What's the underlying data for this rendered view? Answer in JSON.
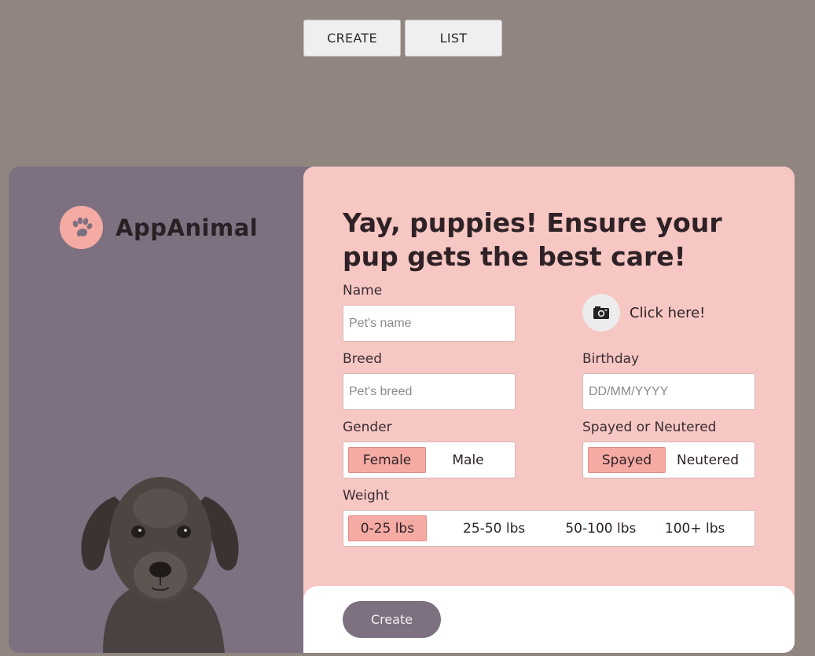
{
  "nav": {
    "create_label": "CREATE",
    "list_label": "LIST"
  },
  "brand": {
    "name": "AppAnimal"
  },
  "form": {
    "headline": "Yay, puppies! Ensure your pup gets the best care!",
    "name": {
      "label": "Name",
      "placeholder": "Pet's name"
    },
    "photo": {
      "label": "Click here!"
    },
    "breed": {
      "label": "Breed",
      "placeholder": "Pet's breed"
    },
    "birthday": {
      "label": "Birthday",
      "placeholder": "DD/MM/YYYY"
    },
    "gender": {
      "label": "Gender",
      "options": [
        "Female",
        "Male"
      ],
      "selected": "Female"
    },
    "spayed": {
      "label": "Spayed or Neutered",
      "options": [
        "Spayed",
        "Neutered"
      ],
      "selected": "Spayed"
    },
    "weight": {
      "label": "Weight",
      "options": [
        "0-25 lbs",
        "25-50 lbs",
        "50-100 lbs",
        "100+ lbs"
      ],
      "selected": "0-25 lbs"
    },
    "submit_label": "Create"
  },
  "colors": {
    "background": "#918580",
    "left_panel": "#7d7080",
    "right_panel": "#f7c7c3",
    "accent": "#f5aaa3"
  }
}
